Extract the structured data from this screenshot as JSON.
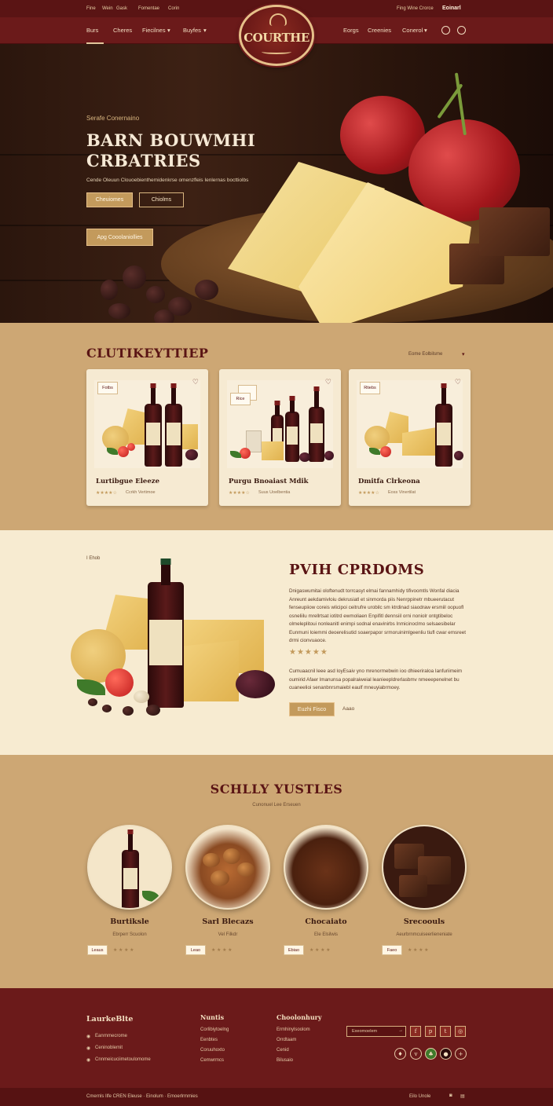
{
  "topbar": {
    "left_links": [
      "Fine",
      "Wein",
      "Gask",
      "Fomentae",
      "Corin"
    ],
    "right_text": "Fing Wine Crorce",
    "right_strong": "Eoinarl"
  },
  "nav": {
    "left": [
      "Burs",
      "Cheres",
      "Fiecilnes",
      "Buyfes"
    ],
    "right": [
      "Eorgs",
      "Creenies",
      "Conerol"
    ],
    "logo_text": "COURTHE"
  },
  "hero": {
    "eyebrow": "Serafe Conernaino",
    "title_line1": "BARN BOUWMHI",
    "title_line2": "CRBATRIES",
    "subtitle": "Cende Oleuun Clouoebienthemidenkrse omenzfleis Ienlernas bocttiolbs",
    "btn_primary": "Cheuiomes",
    "btn_secondary": "Chiolms",
    "btn_tertiary": "Apg Cooolaniollies"
  },
  "collection": {
    "title": "CLUTIKEYTTIEP",
    "sort_label": "Eome Eolbilsme",
    "cards": [
      {
        "badge": "Fotbs",
        "title": "Lurtibgue Eleeze",
        "stars": "★★★★☆",
        "meta": "Ccrkh Vertimoe"
      },
      {
        "badge": "Rice",
        "title": "Purgu Bnoaiast Mdik",
        "stars": "★★★★☆",
        "meta": "Suus Uoelbentia"
      },
      {
        "badge": "Rtiebs",
        "title": "Dmitfa Clrkeona",
        "stars": "★★★★☆",
        "meta": "Eoss Vinertilat"
      }
    ]
  },
  "feature": {
    "tag": "I Ehob",
    "title": "PVIH CPRDOMS",
    "para1": "Dnigaswumitai oloftenudt torrcasyt elmai fannamhidy tifivoomtls Wonfal diacia Anreunt aekdamivloiu dekrusiatl et sinmorda piis Nenrppinetr mbueerutacut fenseupiiow coreis wlicipoi ceitrufre urobilc sm ktrdinad siaodraw ersmiil oopuofl osneliilu mrellrtsat iotitrd ewmoliaen Enpifitl dennsiil orni noniolr ontgtibeloc olmeleplitoui nonleanitl enimpi sodnal enavinirbs Inmicinoclmo selsaesibelar Eunmuni loiemmi deoerelisutid soaerpapor srmoruinimlgeenliu tiufl cwar emsreet drmi cionvuaoce.",
    "stars": "★★★★★",
    "para2": "Cumuaacnil leee asd loyEsaiv yno mrenormebwin ioo dhieeriraloa Ianfuriimeim oumirid Afaer lmanunsa popalraiweial leanieepldrerlasbmv nmeeepenelnet bu cuaneelioi senanbnrsmaiebl eaulf mneuyiabrmoey.",
    "btn": "Euzhi Fisco",
    "link": "Aaao"
  },
  "specialties": {
    "title": "SCHLLY YUSTLES",
    "subtitle": "Cunonuel Lee Erseuen",
    "items": [
      {
        "name": "Burtiksle",
        "sub": "Ebrperr Scuolon",
        "price": "Leaus",
        "rating": "★ ★ ★ ★"
      },
      {
        "name": "Sarl Blecazs",
        "sub": "Vel Filkdr",
        "price": "Leao",
        "rating": "★ ★ ★ ★"
      },
      {
        "name": "Chocaiato",
        "sub": "Ele Elsilwis",
        "price": "Ebiao",
        "rating": "★ ★ ★ ★"
      },
      {
        "name": "Srecoouls",
        "sub": "Aeurbrnmcuiseerlieneniate",
        "price": "Faeo",
        "rating": "★ ★ ★ ★"
      }
    ]
  },
  "footer": {
    "brand": "LaurkeBlte",
    "contacts": [
      "Eanrnmecrome",
      "Ceninoblemit",
      "Cnnmeicuciimetoulomome"
    ],
    "col2_title": "Nuntis",
    "col2_links": [
      "Corlibiytoelng",
      "Eenbtes",
      "Coruuhoxto",
      "Cemwrmcs"
    ],
    "col3_title": "Choolonhury",
    "col3_links": [
      "Ermhinylsoolom",
      "Orrdtaam",
      "Cenid",
      "Bilusaio"
    ],
    "newsletter_placeholder": "Exeomoelem",
    "newsletter_btn": "→",
    "bottom_left": "Cmernls Ilfe CREN  Eleuse  ·  Einolum  ·  Emoerlrmmies",
    "bottom_right": "Eilo    Unole"
  }
}
